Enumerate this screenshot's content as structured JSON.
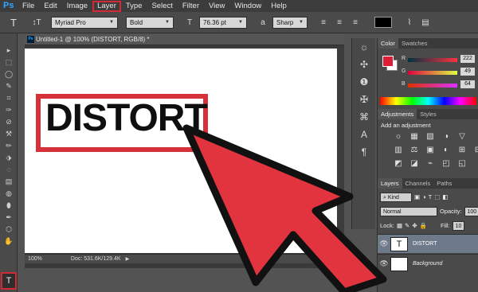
{
  "app": {
    "logo": "Ps"
  },
  "menu": [
    "File",
    "Edit",
    "Image",
    "Layer",
    "Type",
    "Select",
    "Filter",
    "View",
    "Window",
    "Help"
  ],
  "menu_highlight": "Layer",
  "options": {
    "tool_icon": "T",
    "orientation_icon": "↕T",
    "font_family": "Myriad Pro",
    "font_style": "Bold",
    "size_icon": "T",
    "font_size": "76.36 pt",
    "aa_icon": "a",
    "antialias": "Sharp",
    "text_color": "#000000"
  },
  "tools": [
    "▸",
    "⬚",
    "◯",
    "✎",
    "⌗",
    "✑",
    "⊘",
    "⚒",
    "✏",
    "⬗",
    "◌",
    "▤",
    "◍",
    "⬮",
    "✒",
    "⬡",
    "✋"
  ],
  "type_tool": "T",
  "document": {
    "tab_title": "Untitled-1 @ 100% (DISTORT, RGB/8) *",
    "canvas_text": "DISTORT",
    "zoom": "100%",
    "doc_info": "Doc: 531.6K/129.4K"
  },
  "iconcol": [
    "☼",
    "✣",
    "❶",
    "✠",
    "⌘",
    "A",
    "¶"
  ],
  "color_panel": {
    "tabs": [
      "Color",
      "Swatches"
    ],
    "fg": "#de1e37",
    "bg": "#ffffff",
    "r_label": "R",
    "r": "222",
    "g_label": "G",
    "g": "49",
    "b_label": "B",
    "b": "64"
  },
  "adjustments": {
    "tabs": [
      "Adjustments",
      "Styles"
    ],
    "title": "Add an adjustment",
    "row1": [
      "☼",
      "▦",
      "▧",
      "◑",
      "▽",
      ""
    ],
    "row2": [
      "▥",
      "⚖",
      "▣",
      "◐",
      "⊞",
      "⊟"
    ],
    "row3": [
      "◩",
      "◪",
      "⌁",
      "◰",
      "◱",
      ""
    ]
  },
  "layers": {
    "tabs": [
      "Layers",
      "Channels",
      "Paths"
    ],
    "kind": "Kind",
    "blend_mode": "Normal",
    "opacity_label": "Opacity:",
    "opacity": "100",
    "lock_label": "Lock:",
    "fill_label": "Fill:",
    "fill": "10",
    "items": [
      {
        "name": "DISTORT",
        "thumb": "T"
      },
      {
        "name": "Background",
        "thumb": ""
      }
    ]
  }
}
